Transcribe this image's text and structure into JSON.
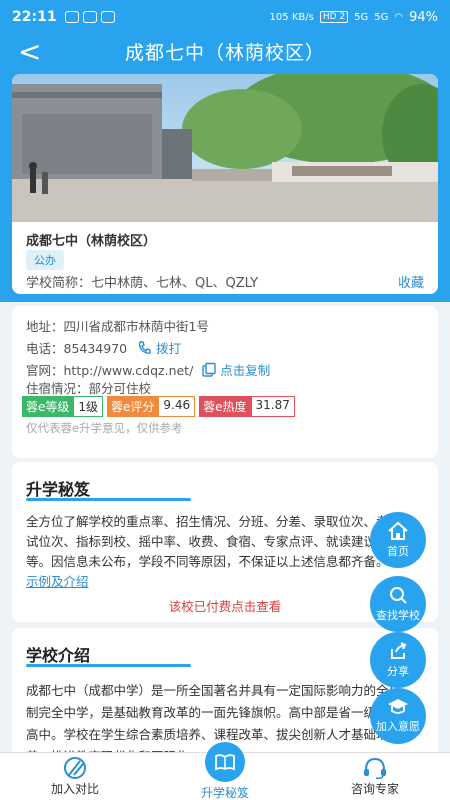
{
  "status": {
    "time": "22:11",
    "speed": "105 KB/s",
    "hd": "HD 2",
    "net1": "5G",
    "net2": "5G",
    "battery": "94%"
  },
  "nav": {
    "back": "<",
    "title": "成都七中（林荫校区）"
  },
  "school": {
    "name": "成都七中（林荫校区）",
    "type_tag": "公办",
    "abbr": "学校简称：七中林荫、七林、QL、QZLY",
    "collect": "收藏"
  },
  "info": {
    "address": "地址：四川省成都市林荫中街1号",
    "phone_label": "电话：85434970",
    "dial": "拨打",
    "website": "官网：http://www.cdqz.net/",
    "copy": "点击复制",
    "boarding": "住宿情况：部分可住校",
    "rating": [
      {
        "k": "蓉e等级",
        "v": "1级",
        "color": "#3bb76a"
      },
      {
        "k": "蓉e评分",
        "v": "9.46",
        "color": "#f08a3c"
      },
      {
        "k": "蓉e热度",
        "v": "31.87",
        "color": "#e0505a"
      }
    ],
    "note": "仅代表蓉e升学意见，仅供参考"
  },
  "secret": {
    "title": "升学秘笈",
    "body": "全方位了解学校的重点率、招生情况、分班、分差、录取位次、考试位次、指标到校、摇中率、收费、食宿、专家点评、就读建议等。因信息未公布，学段不同等原因，不保证以上述信息都齐备。",
    "link": "示例及介绍",
    "paid": "该校已付费点击查看"
  },
  "intro": {
    "title": "学校介绍",
    "body": "成都七中（成都中学）是一所全国著名并具有一定国际影响力的全日制完全中学，是基础教育改革的一面先锋旗帜。高中部是省一级示范高中。学校在学生综合素质培养、课程改革、拔尖创新人才基础培养、推进教育现代化和国际化"
  },
  "fabs": [
    {
      "label": "首页",
      "icon": "home-icon"
    },
    {
      "label": "查找学校",
      "icon": "search-icon"
    },
    {
      "label": "分享",
      "icon": "share-icon"
    },
    {
      "label": "加入意愿",
      "icon": "graduation-cap-icon"
    }
  ],
  "tabs": [
    {
      "label": "加入对比",
      "icon": "compare-icon"
    },
    {
      "label": "升学秘笈",
      "icon": "book-icon"
    },
    {
      "label": "咨询专家",
      "icon": "headset-icon"
    }
  ],
  "colors": {
    "primary": "#2aa3ee",
    "link": "#2a8fd0",
    "alert": "#d84040"
  }
}
